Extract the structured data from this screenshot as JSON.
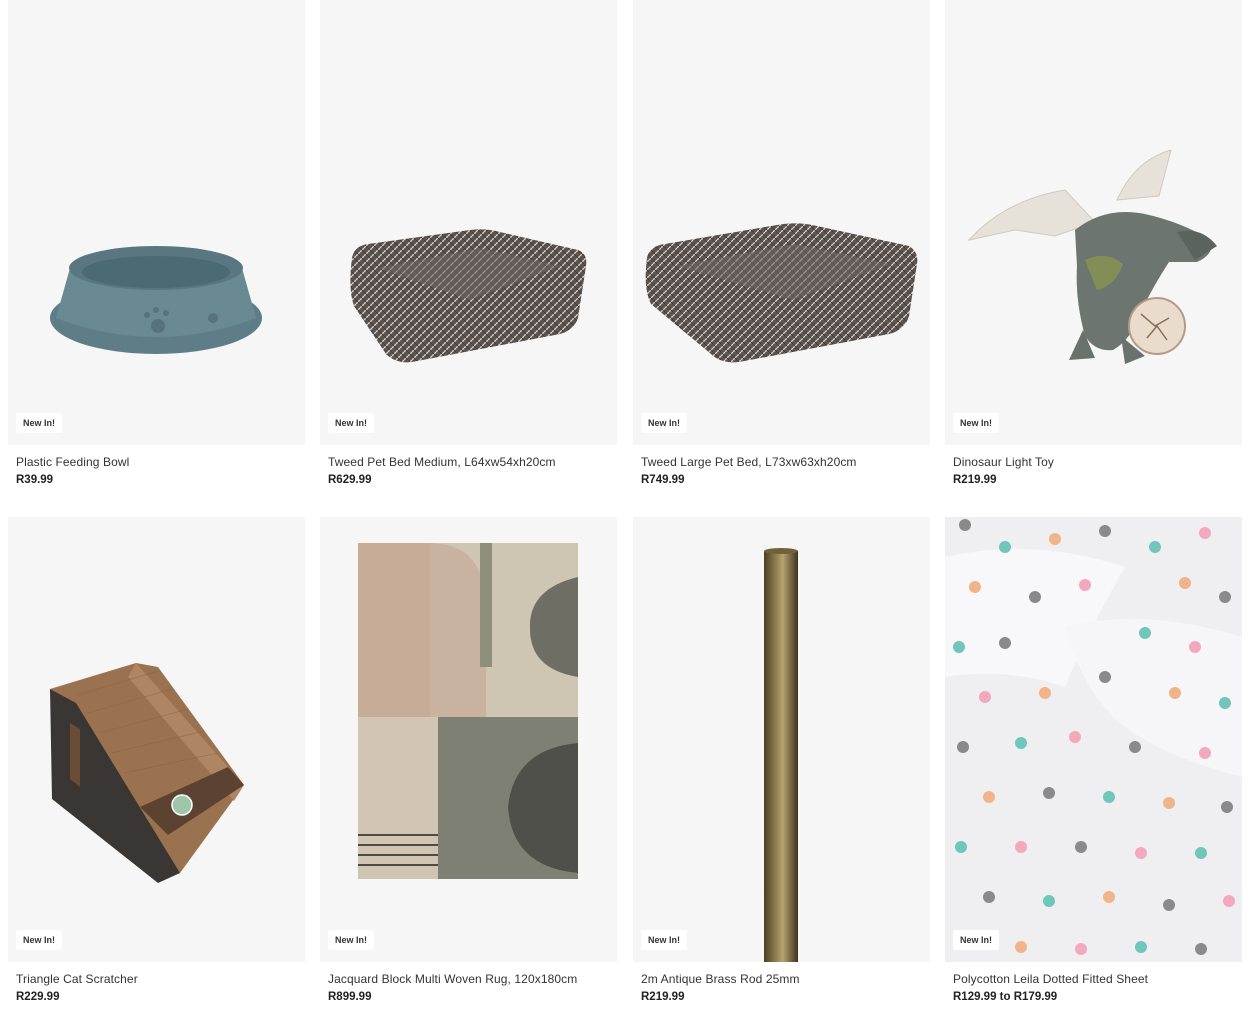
{
  "products": [
    {
      "badge": "New In!",
      "title": "Plastic Feeding Bowl",
      "price": "R39.99",
      "image": "pet-bowl-image"
    },
    {
      "badge": "New In!",
      "title": "Tweed Pet Bed Medium, L64xw54xh20cm",
      "price": "R629.99",
      "image": "pet-bed-image"
    },
    {
      "badge": "New In!",
      "title": "Tweed Large Pet Bed, L73xw63xh20cm",
      "price": "R749.99",
      "image": "pet-bed-image"
    },
    {
      "badge": "New In!",
      "title": "Dinosaur Light Toy",
      "price": "R219.99",
      "image": "dinosaur-toy-image"
    },
    {
      "badge": "New In!",
      "title": "Triangle Cat Scratcher",
      "price": "R229.99",
      "image": "cat-scratcher-image"
    },
    {
      "badge": "New In!",
      "title": "Jacquard Block Multi Woven Rug, 120x180cm",
      "price": "R899.99",
      "image": "rug-image"
    },
    {
      "badge": "New In!",
      "title": "2m Antique Brass Rod 25mm",
      "price": "R219.99",
      "image": "brass-rod-image"
    },
    {
      "badge": "New In!",
      "title": "Polycotton Leila Dotted Fitted Sheet",
      "price": "R129.99 to R179.99",
      "image": "dotted-sheet-image"
    }
  ]
}
